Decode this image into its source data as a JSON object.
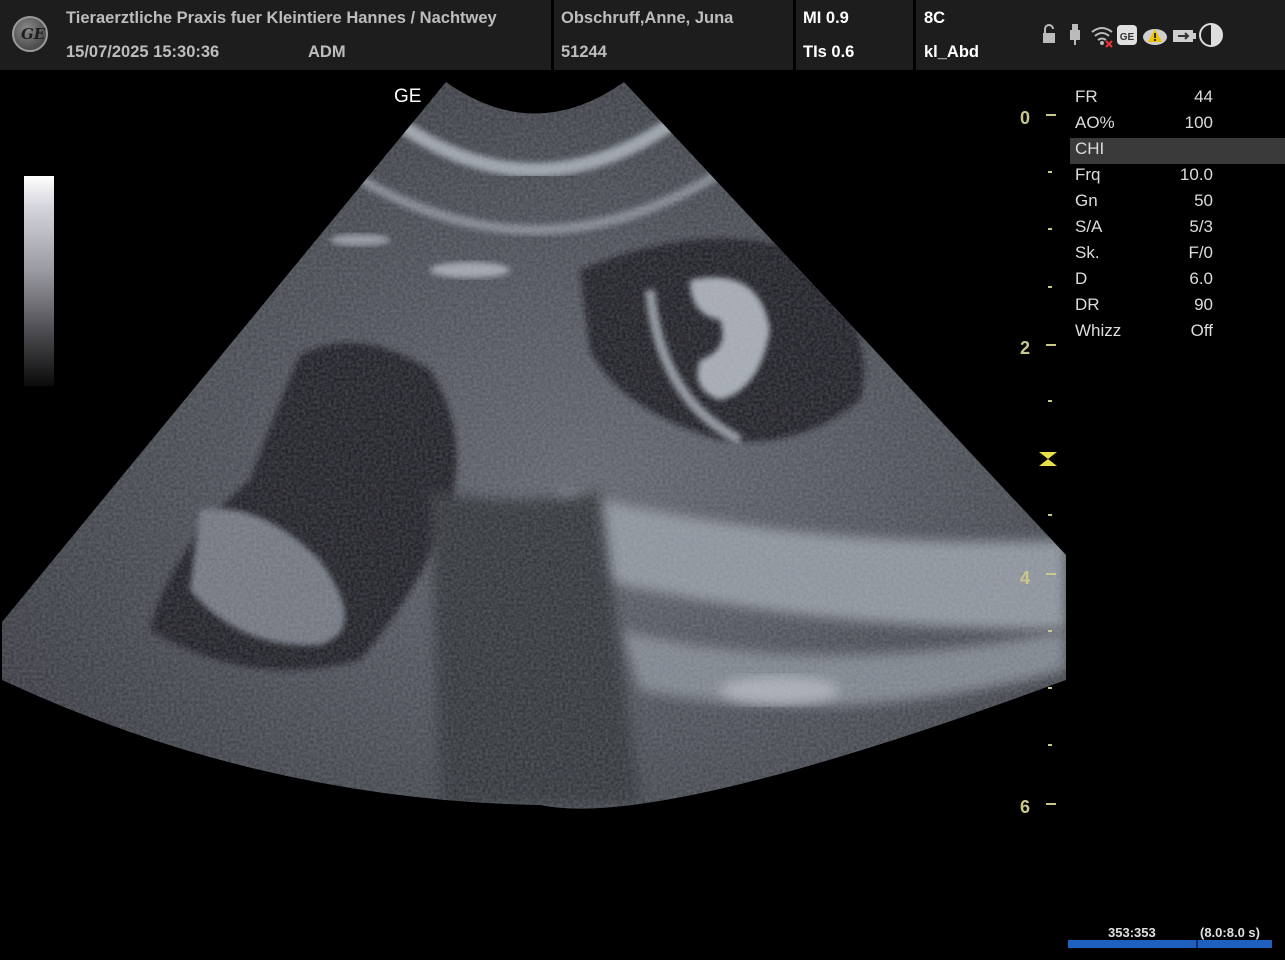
{
  "header": {
    "clinic": "Tieraerztliche Praxis fuer Kleintiere Hannes / Nachtwey",
    "datetime": "15/07/2025 15:30:36",
    "operator": "ADM",
    "patient_name": "Obschruff,Anne, Juna",
    "patient_id": "51244",
    "mi": "MI 0.9",
    "tis": "TIs 0.6",
    "probe": "8C",
    "preset": "kl_Abd",
    "logo_text": "GE"
  },
  "status_icons": [
    "lock-icon",
    "usb-icon",
    "wifi-icon",
    "ge-service-icon",
    "warning-icon",
    "battery-plug-icon",
    "contrast-icon"
  ],
  "image": {
    "orientation_marker": "GE"
  },
  "depth_scale": {
    "unit": "cm",
    "labels": [
      "0",
      "2",
      "4",
      "6"
    ]
  },
  "parameters": [
    {
      "name": "FR",
      "value": "44"
    },
    {
      "name": "AO%",
      "value": "100"
    },
    {
      "name": "CHI",
      "value": ""
    },
    {
      "name": "Frq",
      "value": "10.0"
    },
    {
      "name": "Gn",
      "value": "50"
    },
    {
      "name": "S/A",
      "value": "5/3"
    },
    {
      "name": "Sk.",
      "value": "F/0"
    },
    {
      "name": "D",
      "value": "6.0"
    },
    {
      "name": "DR",
      "value": "90"
    },
    {
      "name": "Whizz",
      "value": "Off"
    }
  ],
  "cine": {
    "frames": "353:353",
    "time": "(8.0:8.0 s)"
  },
  "colors": {
    "header_bg": "#1d1d1d",
    "ruler": "#c9c78a",
    "cine_bar": "#1f5fbf",
    "highlight": "#3a3a3a"
  }
}
